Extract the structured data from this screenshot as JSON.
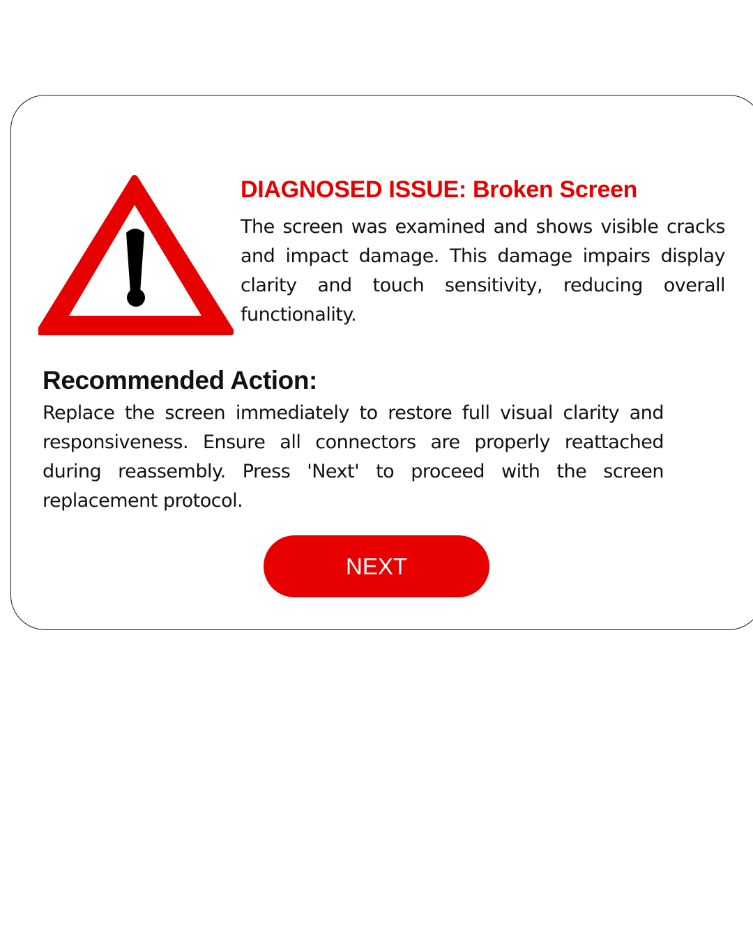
{
  "dialog": {
    "issue_title": "DIAGNOSED ISSUE: Broken Screen",
    "issue_description": "The screen was examined and shows visible cracks and impact damage. This damage impairs display clarity and touch sensitivity, reducing overall functionality.",
    "action_title": "Recommended Action:",
    "action_description": "Replace the screen immediately to restore full visual clarity and responsiveness. Ensure all connectors are properly reattached during reassembly. Press 'Next' to proceed with the screen replacement protocol.",
    "next_button_label": "NEXT",
    "icon": "warning-triangle-icon"
  },
  "colors": {
    "accent": "#e60000",
    "text": "#111111",
    "background": "#ffffff"
  }
}
